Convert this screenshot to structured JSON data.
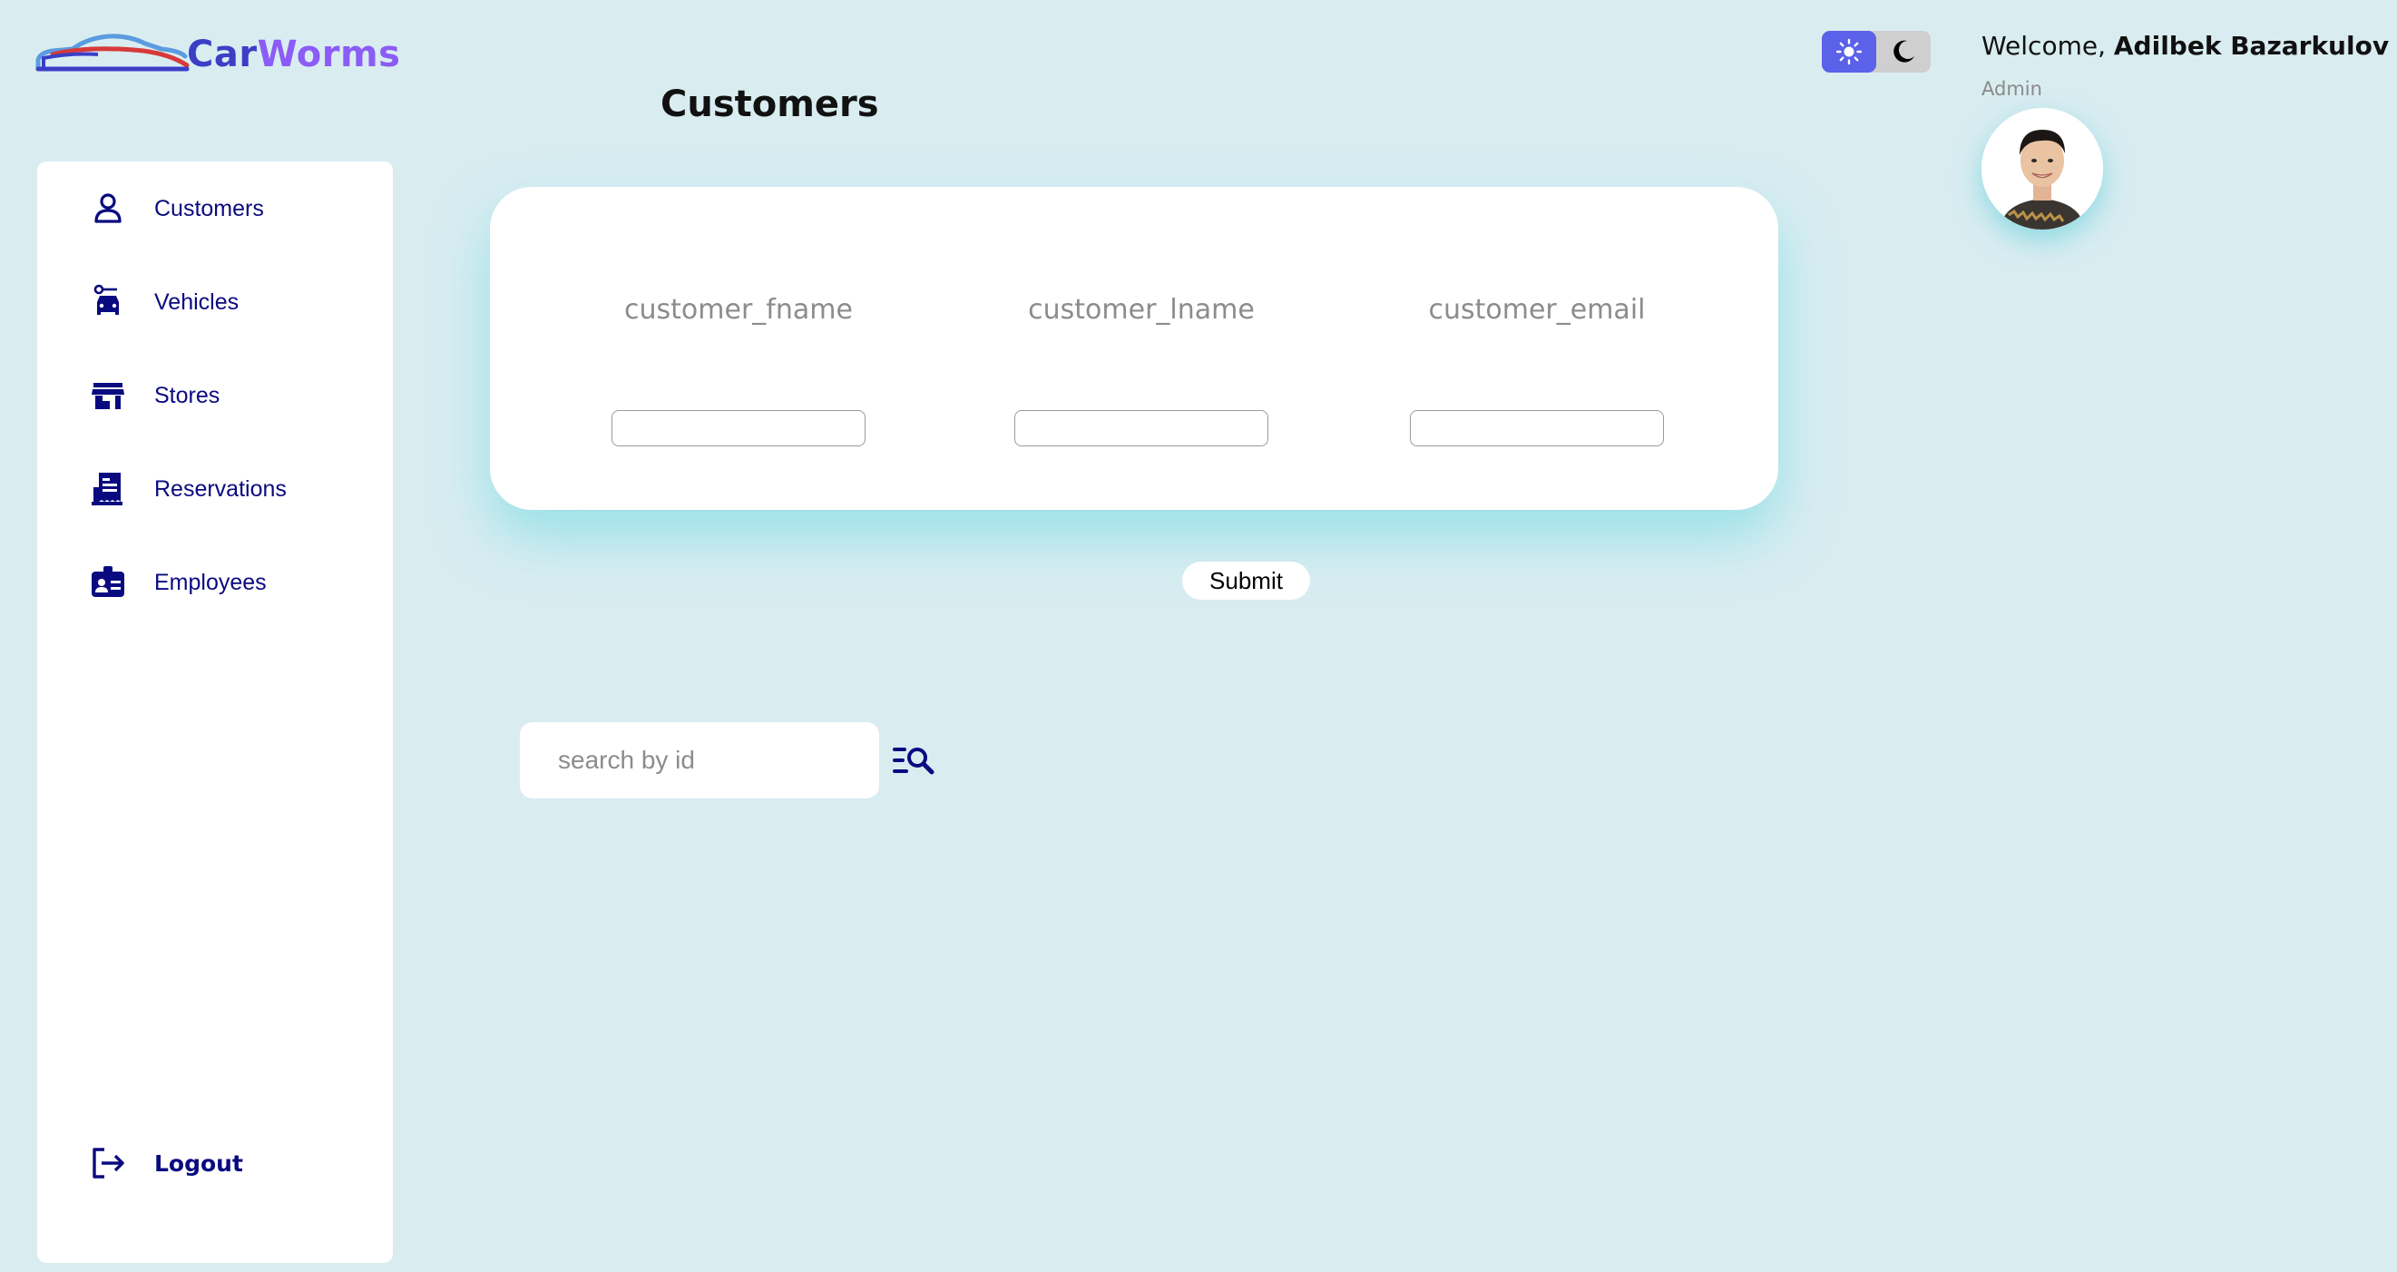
{
  "app": {
    "brand_part1": "Car",
    "brand_part2": "Worms",
    "page_title": "Customers"
  },
  "header": {
    "welcome_prefix": "Welcome, ",
    "user_name": "Adilbek Bazarkulov",
    "role": "Admin",
    "theme_active": "light"
  },
  "sidebar": {
    "items": [
      {
        "label": "Customers",
        "icon": "person-icon"
      },
      {
        "label": "Vehicles",
        "icon": "car-icon"
      },
      {
        "label": "Stores",
        "icon": "store-icon"
      },
      {
        "label": "Reservations",
        "icon": "receipt-icon"
      },
      {
        "label": "Employees",
        "icon": "id-badge-icon"
      }
    ],
    "logout_label": "Logout"
  },
  "form": {
    "fields": [
      {
        "label": "customer_fname",
        "value": ""
      },
      {
        "label": "customer_lname",
        "value": ""
      },
      {
        "label": "customer_email",
        "value": ""
      }
    ],
    "submit_label": "Submit"
  },
  "search": {
    "placeholder": "search by id",
    "value": ""
  },
  "colors": {
    "background": "#d9edf1",
    "nav_text": "#0a0a80",
    "toggle_active": "#5b61e8",
    "brand_car": "#3a3fc6",
    "brand_worms": "#8b5cf6"
  }
}
